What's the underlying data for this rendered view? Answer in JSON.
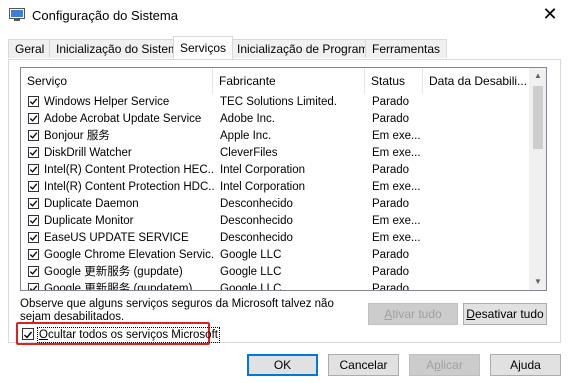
{
  "window": {
    "title": "Configuração do Sistema",
    "close_glyph": "✕"
  },
  "tabs": [
    {
      "label": "Geral",
      "active": false
    },
    {
      "label": "Inicialização do Sistema",
      "active": false
    },
    {
      "label": "Serviços",
      "active": true
    },
    {
      "label": "Inicialização de Programas",
      "active": false
    },
    {
      "label": "Ferramentas",
      "active": false
    }
  ],
  "table": {
    "headers": [
      "Serviço",
      "Fabricante",
      "Status",
      "Data da Desabili..."
    ],
    "rows": [
      {
        "name": "Windows Helper Service",
        "manufacturer": "TEC Solutions Limited.",
        "status": "Parado",
        "checked": true
      },
      {
        "name": "Adobe Acrobat Update Service",
        "manufacturer": "Adobe Inc.",
        "status": "Parado",
        "checked": true
      },
      {
        "name": "Bonjour 服务",
        "manufacturer": "Apple Inc.",
        "status": "Em exe...",
        "checked": true
      },
      {
        "name": "DiskDrill Watcher",
        "manufacturer": "CleverFiles",
        "status": "Em exe...",
        "checked": true
      },
      {
        "name": "Intel(R) Content Protection HEC...",
        "manufacturer": "Intel Corporation",
        "status": "Parado",
        "checked": true
      },
      {
        "name": "Intel(R) Content Protection HDC...",
        "manufacturer": "Intel Corporation",
        "status": "Em exe...",
        "checked": true
      },
      {
        "name": "Duplicate Daemon",
        "manufacturer": "Desconhecido",
        "status": "Parado",
        "checked": true
      },
      {
        "name": "Duplicate Monitor",
        "manufacturer": "Desconhecido",
        "status": "Em exe...",
        "checked": true
      },
      {
        "name": "EaseUS UPDATE SERVICE",
        "manufacturer": "Desconhecido",
        "status": "Em exe...",
        "checked": true
      },
      {
        "name": "Google Chrome Elevation Servic...",
        "manufacturer": "Google LLC",
        "status": "Parado",
        "checked": true
      },
      {
        "name": "Google 更新服务 (gupdate)",
        "manufacturer": "Google LLC",
        "status": "Parado",
        "checked": true
      },
      {
        "name": "Google 更新服务 (gupdatem)",
        "manufacturer": "Google LLC",
        "status": "Parado",
        "checked": true
      }
    ]
  },
  "note": "Observe que alguns serviços seguros da Microsoft talvez não sejam desabilitados.",
  "buttons": {
    "enable_all": "Ativar tudo",
    "disable_all": "Desativar tudo",
    "ok": "OK",
    "cancel": "Cancelar",
    "apply": "Aplicar",
    "help": "Ajuda"
  },
  "hide_microsoft": {
    "label": "Ocultar todos os serviços Microsoft",
    "checked": true,
    "highlight_color": "#e02020"
  },
  "colors": {
    "accent": "#0078d7"
  }
}
